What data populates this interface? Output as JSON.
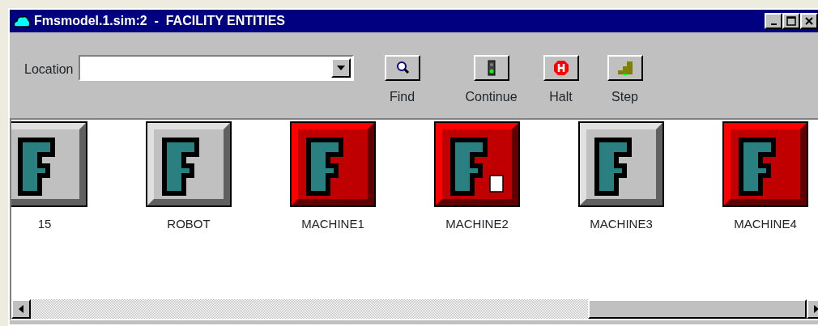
{
  "window": {
    "title": "Fmsmodel.1.sim:2  -  FACILITY ENTITIES"
  },
  "toolbar": {
    "location_label": "Location",
    "buttons": [
      {
        "kind": "find",
        "label": "Find"
      },
      {
        "kind": "continue",
        "label": "Continue"
      },
      {
        "kind": "halt",
        "label": "Halt"
      },
      {
        "kind": "step",
        "label": "Step"
      }
    ]
  },
  "entities": [
    {
      "name": "15",
      "busy": false,
      "marker": false
    },
    {
      "name": "ROBOT",
      "busy": false,
      "marker": false
    },
    {
      "name": "MACHINE1",
      "busy": true,
      "marker": false
    },
    {
      "name": "MACHINE2",
      "busy": true,
      "marker": true
    },
    {
      "name": "MACHINE3",
      "busy": false,
      "marker": false
    },
    {
      "name": "MACHINE4",
      "busy": true,
      "marker": false
    }
  ]
}
